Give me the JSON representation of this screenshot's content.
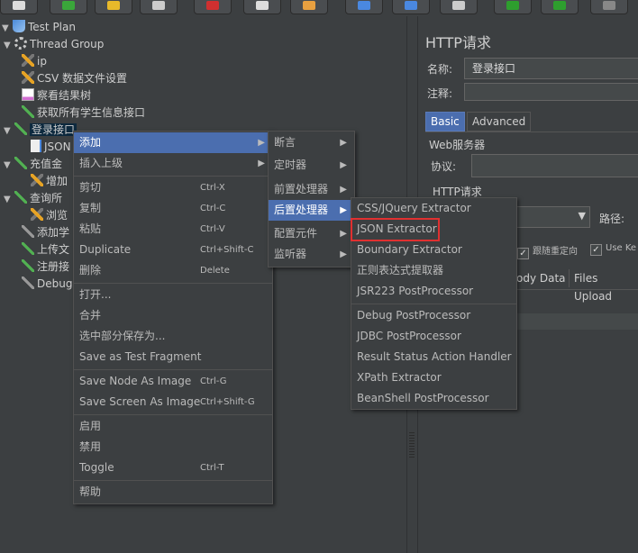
{
  "tree": {
    "items": [
      {
        "label": "Test Plan"
      },
      {
        "label": "Thread Group"
      },
      {
        "label": "ip"
      },
      {
        "label": "CSV 数据文件设置"
      },
      {
        "label": "察看结果树"
      },
      {
        "label": "获取所有学生信息接口"
      },
      {
        "label": "登录接口"
      },
      {
        "label": "JSON"
      },
      {
        "label": "充值金"
      },
      {
        "label": "增加"
      },
      {
        "label": "查询所"
      },
      {
        "label": "浏览"
      },
      {
        "label": "添加学"
      },
      {
        "label": "上传文"
      },
      {
        "label": "注册接"
      },
      {
        "label": "Debug"
      }
    ]
  },
  "context_menu": {
    "items": [
      {
        "label": "添加",
        "shortcut": "",
        "submenu": true
      },
      {
        "label": "插入上级",
        "shortcut": "",
        "submenu": true
      },
      {
        "label": "剪切",
        "shortcut": "Ctrl-X"
      },
      {
        "label": "复制",
        "shortcut": "Ctrl-C"
      },
      {
        "label": "粘贴",
        "shortcut": "Ctrl-V"
      },
      {
        "label": "Duplicate",
        "shortcut": "Ctrl+Shift-C"
      },
      {
        "label": "删除",
        "shortcut": "Delete"
      },
      {
        "label": "打开..."
      },
      {
        "label": "合并"
      },
      {
        "label": "选中部分保存为..."
      },
      {
        "label": "Save as Test Fragment"
      },
      {
        "label": "Save Node As Image",
        "shortcut": "Ctrl-G"
      },
      {
        "label": "Save Screen As Image",
        "shortcut": "Ctrl+Shift-G"
      },
      {
        "label": "启用"
      },
      {
        "label": "禁用"
      },
      {
        "label": "Toggle",
        "shortcut": "Ctrl-T"
      },
      {
        "label": "帮助"
      }
    ]
  },
  "add_menu": {
    "items": [
      {
        "label": "断言"
      },
      {
        "label": "定时器"
      },
      {
        "label": "前置处理器"
      },
      {
        "label": "后置处理器"
      },
      {
        "label": "配置元件"
      },
      {
        "label": "监听器"
      }
    ]
  },
  "post_menu": {
    "items": [
      {
        "label": "CSS/JQuery Extractor"
      },
      {
        "label": "JSON Extractor"
      },
      {
        "label": "Boundary Extractor"
      },
      {
        "label": "正则表达式提取器"
      },
      {
        "label": "JSR223 PostProcessor"
      },
      {
        "label": "Debug PostProcessor"
      },
      {
        "label": "JDBC PostProcessor"
      },
      {
        "label": "Result Status Action Handler"
      },
      {
        "label": "XPath Extractor"
      },
      {
        "label": "BeanShell PostProcessor"
      }
    ]
  },
  "panel": {
    "title": "HTTP请求",
    "name_label": "名称:",
    "name_value": "登录接口",
    "comment_label": "注释:",
    "tabs": [
      "Basic",
      "Advanced"
    ],
    "web_server": "Web服务器",
    "protocol_label": "协议:",
    "http_request": "HTTP请求",
    "path_label": "路径:",
    "follow_redirect": "跟随重定向",
    "use_ke": "Use Ke",
    "body_tab": "ody Data",
    "files_tab": "Files Upload"
  },
  "colors": {
    "background": "#3c3f41",
    "selection": "#4b6eaf",
    "highlight_box": "#e03030"
  }
}
